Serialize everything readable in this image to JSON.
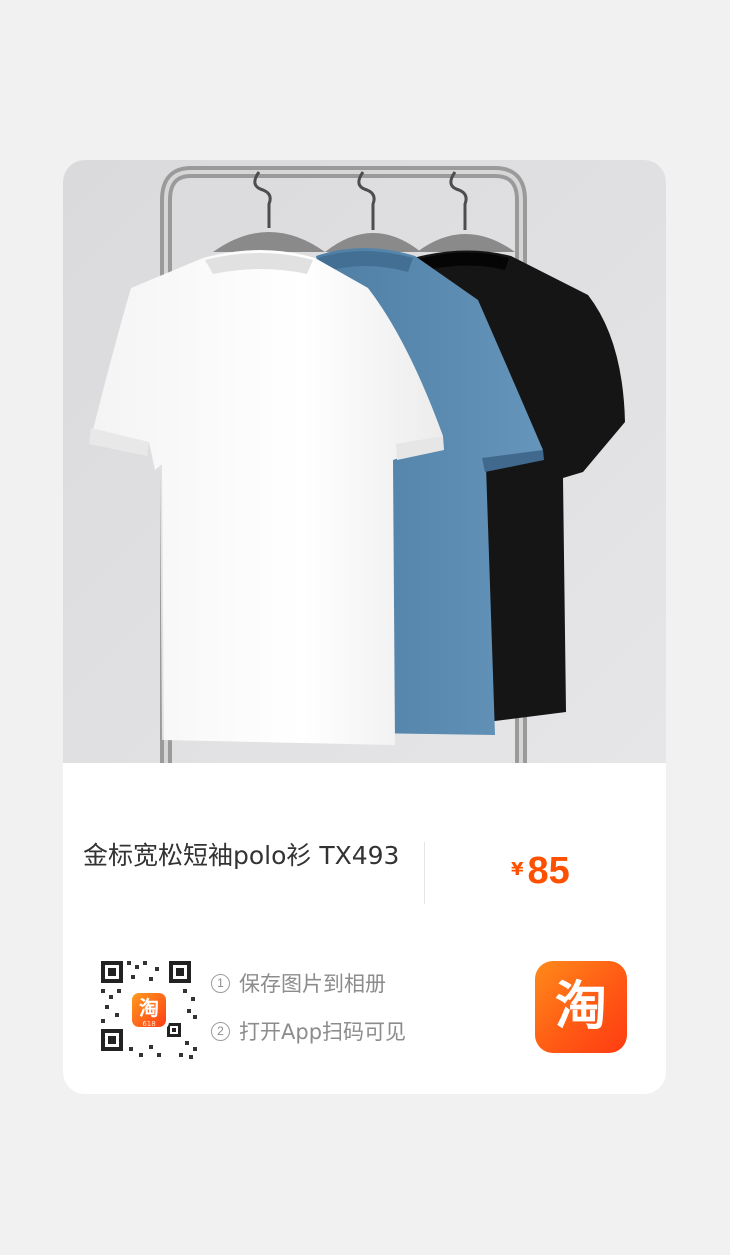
{
  "product": {
    "title": "金标宽松短袖polo衫 TX493",
    "image_icon": "product-photo-three-polo-shirts-on-rack",
    "price_currency": "¥",
    "price_amount": "85"
  },
  "share": {
    "qr_icon": "qr-code-icon",
    "qr_logo_text": "淘",
    "qr_logo_sub": "618",
    "step1_num": "1",
    "step1_text": "保存图片到相册",
    "step2_num": "2",
    "step2_text": "打开App扫码可见",
    "app_badge_text": "淘",
    "app_badge_icon": "taobao-app-icon"
  },
  "colors": {
    "page_bg": "#f1f1f1",
    "card_bg": "#ffffff",
    "accent": "#ff5000",
    "title_text": "#333333",
    "muted_text": "#8c8c8c",
    "shirt_white": "#ffffff",
    "shirt_blue": "#5a89b0",
    "shirt_black": "#141414"
  }
}
